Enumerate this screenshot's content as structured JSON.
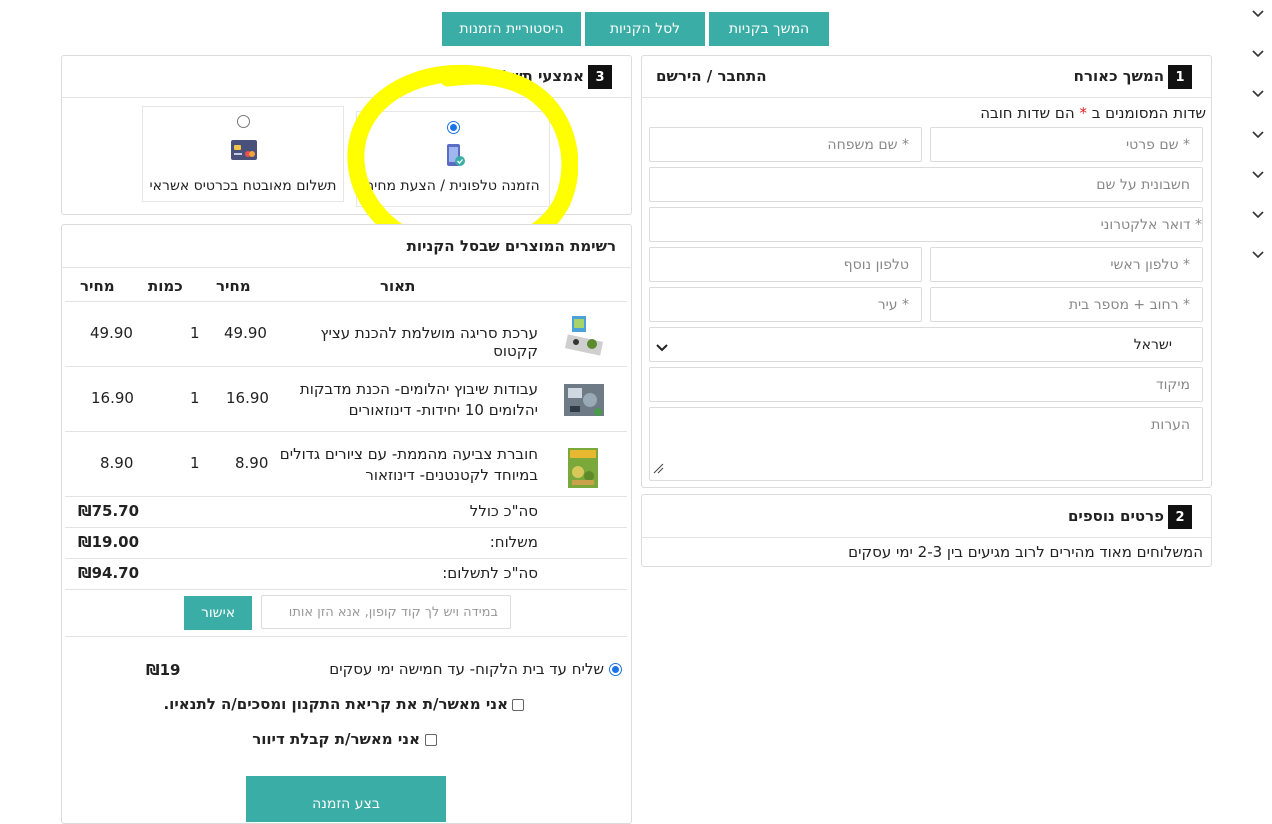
{
  "top_buttons": {
    "continue_shopping": "המשך בקניות",
    "to_cart": "לסל הקניות",
    "order_history": "היסטוריית הזמנות"
  },
  "step1": {
    "number": "1",
    "title": "המשך כאורח",
    "login_link": "התחבר / הירשם",
    "required_note_pre": "שדות המסומנים ב",
    "required_star": "*",
    "required_note_post": "הם שדות חובה",
    "fields": {
      "first_name": "* שם פרטי",
      "last_name": "* שם משפחה",
      "invoice_name": "חשבונית על שם",
      "email": "דואר אלקטרוני *",
      "main_phone": "* טלפון ראשי",
      "extra_phone": "טלפון נוסף",
      "street": "* רחוב + מספר בית",
      "city": "* עיר",
      "country": "ישראל",
      "zip": "מיקוד",
      "notes": "הערות"
    }
  },
  "step2": {
    "number": "2",
    "title": "פרטים נוספים",
    "text": "המשלוחים מאוד מהירים לרוב מגיעים בין 2-3 ימי עסקים"
  },
  "step3": {
    "number": "3",
    "title": "אמצעי תשלום",
    "options": [
      {
        "label": "הזמנה טלפונית / הצעת מחיר",
        "selected": true,
        "icon": "phone-order-icon"
      },
      {
        "label": "תשלום מאובטח בכרטיס אשראי",
        "selected": false,
        "icon": "credit-card-icon"
      }
    ]
  },
  "cart": {
    "title": "רשימת המוצרים שבסל הקניות",
    "headers": {
      "description": "תאור",
      "price": "מחיר",
      "qty": "כמות",
      "total": "מחיר"
    },
    "items": [
      {
        "desc_line1": "ערכת סריגה מושלמת להכנת עציץ קקטוס",
        "desc_line2": "",
        "price": "49.90",
        "qty": "1",
        "total": "49.90"
      },
      {
        "desc_line1": "עבודות שיבוץ יהלומים- הכנת מדבקות",
        "desc_line2": "יהלומים 10 יחידות- דינוזאורים",
        "price": "16.90",
        "qty": "1",
        "total": "16.90"
      },
      {
        "desc_line1": "חוברת צביעה מהממת- עם ציורים גדולים",
        "desc_line2": "במיוחד לקטנטנים- דינוזאור",
        "price": "8.90",
        "qty": "1",
        "total": "8.90"
      }
    ],
    "subtotal_label": "סה\"כ כולל",
    "subtotal_value": "₪75.70",
    "shipping_label": "משלוח:",
    "shipping_value": "₪19.00",
    "grand_label": "סה\"כ לתשלום:",
    "grand_value": "₪94.70",
    "coupon_placeholder": "במידה ויש לך קוד קופון, אנא הזן אותו",
    "coupon_button": "אישור",
    "delivery_option": "שליח עד בית הלקוח- עד חמישה ימי עסקים",
    "delivery_price": "₪19",
    "terms_label": "אני מאשר/ת את קריאת התקנון ומסכים/ה לתנאיו.",
    "mailing_label": "אני מאשר/ת קבלת דיוור",
    "submit_label": "בצע הזמנה"
  },
  "colors": {
    "accent": "#3aaea6",
    "highlight": "#ffff00",
    "required": "#e02020"
  }
}
